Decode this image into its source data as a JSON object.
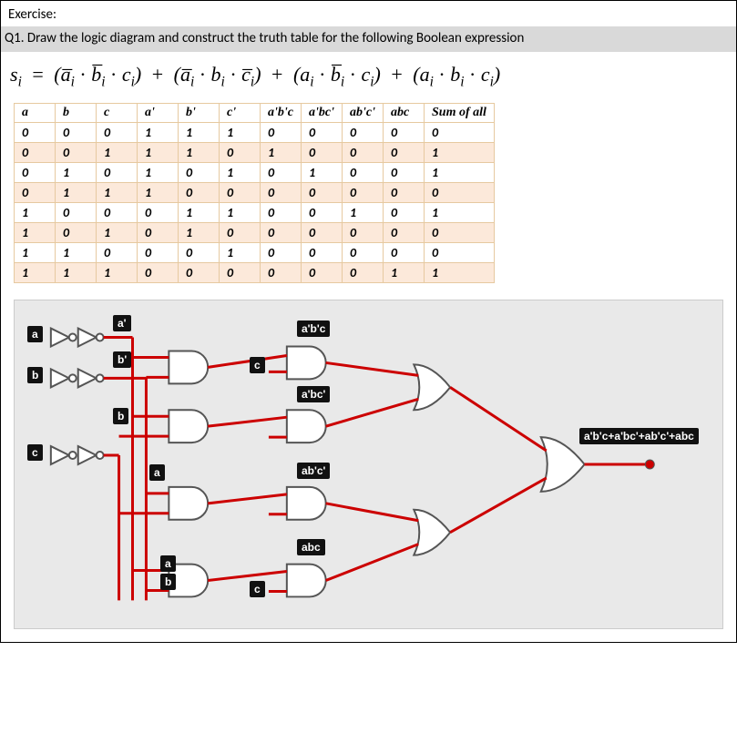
{
  "exerciseLabel": "Exercise:",
  "question": "Q1. Draw the logic diagram and construct the truth table for the following Boolean expression",
  "equation": {
    "lhs": "s",
    "lhsSub": "i",
    "eq": "=",
    "groups": [
      {
        "a": "a̅",
        "b": "b̅",
        "c": "c"
      },
      {
        "a": "a̅",
        "b": "b",
        "c": "c̅"
      },
      {
        "a": "a",
        "b": "b̅",
        "c": "c"
      },
      {
        "a": "a",
        "b": "b",
        "c": "c"
      }
    ],
    "sub": "i",
    "dot": "·",
    "plus": "+"
  },
  "truthTable": {
    "headers": [
      "a",
      "b",
      "c",
      "a'",
      "b'",
      "c'",
      "a'b'c",
      "a'bc'",
      "ab'c'",
      "abc",
      "Sum of all"
    ],
    "rows": [
      [
        "0",
        "0",
        "0",
        "1",
        "1",
        "1",
        "0",
        "0",
        "0",
        "0",
        "0"
      ],
      [
        "0",
        "0",
        "1",
        "1",
        "1",
        "0",
        "1",
        "0",
        "0",
        "0",
        "1"
      ],
      [
        "0",
        "1",
        "0",
        "1",
        "0",
        "1",
        "0",
        "1",
        "0",
        "0",
        "1"
      ],
      [
        "0",
        "1",
        "1",
        "1",
        "0",
        "0",
        "0",
        "0",
        "0",
        "0",
        "0"
      ],
      [
        "1",
        "0",
        "0",
        "0",
        "1",
        "1",
        "0",
        "0",
        "1",
        "0",
        "1"
      ],
      [
        "1",
        "0",
        "1",
        "0",
        "1",
        "0",
        "0",
        "0",
        "0",
        "0",
        "0"
      ],
      [
        "1",
        "1",
        "0",
        "0",
        "0",
        "1",
        "0",
        "0",
        "0",
        "0",
        "0"
      ],
      [
        "1",
        "1",
        "1",
        "0",
        "0",
        "0",
        "0",
        "0",
        "0",
        "1",
        "1"
      ]
    ]
  },
  "circuitLabels": {
    "a": "a",
    "b": "b",
    "c": "c",
    "aP": "a'",
    "bP": "b'",
    "aDup": "a",
    "bDup": "b",
    "cDup": "c",
    "bTag": "b",
    "aTag": "a",
    "t1": "a'b'c",
    "t2": "a'bc'",
    "t3": "ab'c'",
    "t4": "abc",
    "out": "a'b'c+a'bc'+ab'c'+abc"
  }
}
